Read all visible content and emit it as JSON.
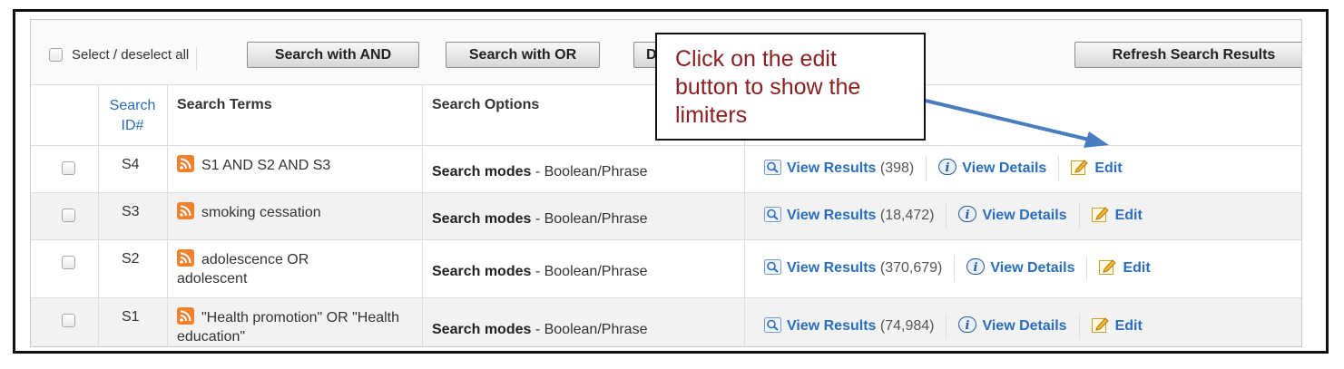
{
  "toolbar": {
    "select_all_label": "Select / deselect all",
    "btn_and": "Search with AND",
    "btn_or": "Search with OR",
    "btn_delete": "De",
    "btn_refresh": "Refresh Search Results"
  },
  "headers": {
    "search_id": "Search ID#",
    "search_terms": "Search Terms",
    "search_options": "Search Options"
  },
  "rows": [
    {
      "id": "S4",
      "terms": "S1 AND S2 AND S3",
      "options_bold": "Search modes",
      "options_rest": " - Boolean/Phrase",
      "view_results": "View Results",
      "count": "(398)",
      "view_details": "View Details",
      "edit": "Edit"
    },
    {
      "id": "S3",
      "terms": "smoking cessation",
      "options_bold": "Search modes",
      "options_rest": " - Boolean/Phrase",
      "view_results": "View Results",
      "count": "(18,472)",
      "view_details": "View Details",
      "edit": "Edit"
    },
    {
      "id": "S2",
      "terms": "adolescence OR adolescent",
      "options_bold": "Search modes",
      "options_rest": " - Boolean/Phrase",
      "view_results": "View Results",
      "count": "(370,679)",
      "view_details": "View Details",
      "edit": "Edit"
    },
    {
      "id": "S1",
      "terms": "\"Health promotion\" OR \"Health education\"",
      "options_bold": "Search modes",
      "options_rest": " - Boolean/Phrase",
      "view_results": "View Results",
      "count": "(74,984)",
      "view_details": "View Details",
      "edit": "Edit"
    }
  ],
  "callout": {
    "text": "Click on the edit button to show the limiters"
  },
  "colors": {
    "link": "#2a6ebb",
    "callout_text": "#8b2020",
    "rss": "#f0822d",
    "arrow": "#4a7cc0"
  },
  "icons": [
    "checkbox-icon",
    "rss-icon",
    "magnifier-icon",
    "info-icon",
    "edit-icon"
  ]
}
